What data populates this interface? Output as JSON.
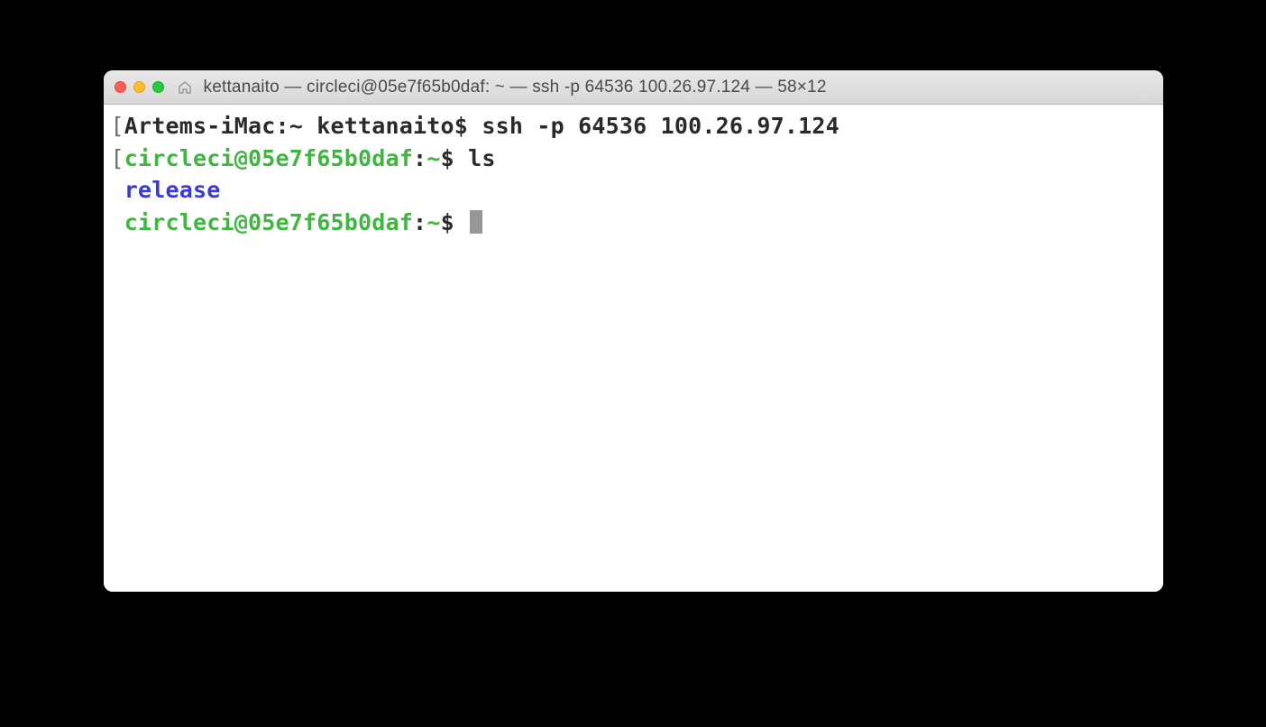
{
  "window": {
    "title": "kettanaito — circleci@05e7f65b0daf: ~ — ssh -p 64536 100.26.97.124 — 58×12"
  },
  "terminal": {
    "line1": {
      "bracket_open": "[",
      "prompt": "Artems-iMac:~ kettanaito$ ",
      "command": "ssh -p 64536 100.26.97.124"
    },
    "line2": {
      "bracket_open": "[",
      "user_host": "circleci@05e7f65b0daf",
      "colon": ":",
      "path": "~",
      "dollar": "$ ",
      "command": "ls"
    },
    "line3": {
      "output": "release"
    },
    "line4": {
      "user_host": "circleci@05e7f65b0daf",
      "colon": ":",
      "path": "~",
      "dollar": "$ "
    }
  }
}
